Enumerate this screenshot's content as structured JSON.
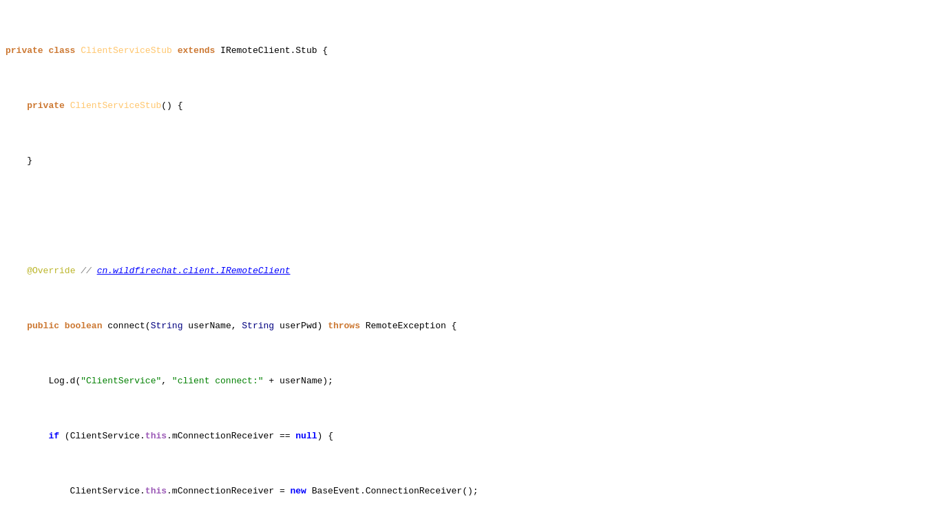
{
  "code": {
    "lines": [
      {
        "id": 1,
        "highlighted": false
      },
      {
        "id": 2,
        "highlighted": false
      },
      {
        "id": 3,
        "highlighted": false
      },
      {
        "id": 4,
        "highlighted": false
      },
      {
        "id": 5,
        "highlighted": false
      },
      {
        "id": 6,
        "highlighted": false
      },
      {
        "id": 7,
        "highlighted": false
      },
      {
        "id": 8,
        "highlighted": false
      },
      {
        "id": 9,
        "highlighted": false
      },
      {
        "id": 10,
        "highlighted": false
      },
      {
        "id": 11,
        "highlighted": false
      },
      {
        "id": 12,
        "highlighted": false
      },
      {
        "id": 13,
        "highlighted": false
      },
      {
        "id": 14,
        "highlighted": false
      },
      {
        "id": 15,
        "highlighted": false
      },
      {
        "id": 16,
        "highlighted": false
      },
      {
        "id": 17,
        "highlighted": false
      },
      {
        "id": 18,
        "highlighted": false
      },
      {
        "id": 19,
        "highlighted": false
      },
      {
        "id": 20,
        "highlighted": false
      },
      {
        "id": 21,
        "highlighted": false
      },
      {
        "id": 22,
        "highlighted": false
      },
      {
        "id": 23,
        "highlighted": false
      },
      {
        "id": 24,
        "highlighted": true
      },
      {
        "id": 25,
        "highlighted": false
      },
      {
        "id": 26,
        "highlighted": false
      },
      {
        "id": 27,
        "highlighted": false
      },
      {
        "id": 28,
        "highlighted": false
      },
      {
        "id": 29,
        "highlighted": false
      },
      {
        "id": 30,
        "highlighted": false
      },
      {
        "id": 31,
        "highlighted": false
      },
      {
        "id": 32,
        "highlighted": false
      },
      {
        "id": 33,
        "highlighted": false
      }
    ]
  }
}
